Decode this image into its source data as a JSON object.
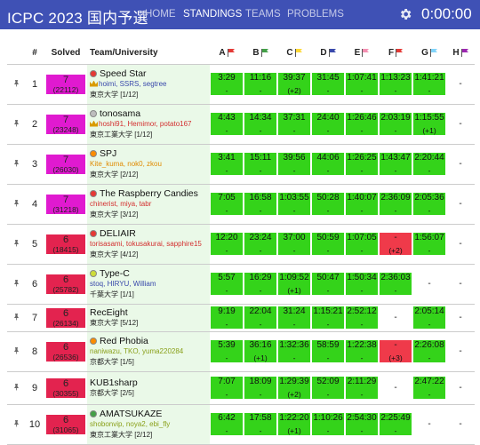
{
  "header": {
    "title": "ICPC 2023 国内予選",
    "nav": [
      {
        "label": "HOME",
        "active": false
      },
      {
        "label": "STANDINGS",
        "active": true
      },
      {
        "label": "TEAMS",
        "active": false
      },
      {
        "label": "PROBLEMS",
        "active": false
      }
    ],
    "clock": "0:00:00"
  },
  "columns": {
    "rank": "#",
    "solved": "Solved",
    "team": "Team/University",
    "problems": [
      {
        "letter": "A",
        "flag_color": "#e53935"
      },
      {
        "letter": "B",
        "flag_color": "#43a047"
      },
      {
        "letter": "C",
        "flag_color": "#fdd835"
      },
      {
        "letter": "D",
        "flag_color": "#3949ab"
      },
      {
        "letter": "E",
        "flag_color": "#f48fb1"
      },
      {
        "letter": "F",
        "flag_color": "#e53935"
      },
      {
        "letter": "G",
        "flag_color": "#81d4fa"
      },
      {
        "letter": "H",
        "flag_color": "#9c27b0"
      }
    ]
  },
  "teams": [
    {
      "rank": "1",
      "solved": "7",
      "penalty": "(22112)",
      "color": "magenta",
      "name": "Speed Star",
      "dot": "#e53935",
      "members": "hoimi, SSRS, segtree",
      "members_color": "blue",
      "univ": "東京大学 [1/12]",
      "crowns": true,
      "height": "row",
      "cells": [
        [
          "ac",
          "3:29",
          "-"
        ],
        [
          "ac",
          "11:16",
          "-"
        ],
        [
          "ac",
          "39:37",
          "(+2)"
        ],
        [
          "ac",
          "31:45",
          "-"
        ],
        [
          "ac",
          "1:07:41",
          "-"
        ],
        [
          "ac",
          "1:13:23",
          "-"
        ],
        [
          "ac",
          "1:41:21",
          "-"
        ],
        [
          "none",
          "-",
          ""
        ]
      ]
    },
    {
      "rank": "2",
      "solved": "7",
      "penalty": "(23248)",
      "color": "magenta",
      "name": "tonosama",
      "dot": "#bdbdbd",
      "members": "hoshi91, Hemimor, potato167",
      "members_color": "red",
      "univ": "東京工業大学 [1/12]",
      "crowns": true,
      "height": "row",
      "cells": [
        [
          "ac",
          "4:43",
          "-"
        ],
        [
          "ac",
          "14:34",
          "-"
        ],
        [
          "ac",
          "37:31",
          "-"
        ],
        [
          "ac",
          "24:40",
          "-"
        ],
        [
          "ac",
          "1:26:46",
          "-"
        ],
        [
          "ac",
          "2:03:19",
          "-"
        ],
        [
          "ac",
          "1:15:55",
          "(+1)"
        ],
        [
          "none",
          "-",
          ""
        ]
      ]
    },
    {
      "rank": "3",
      "solved": "7",
      "penalty": "(26030)",
      "color": "magenta",
      "name": "SPJ",
      "dot": "#fb8c00",
      "members": "Kite_kuma, nok0, zkou",
      "members_color": "orange",
      "univ": "東京大学 [2/12]",
      "crowns": false,
      "height": "row",
      "cells": [
        [
          "ac",
          "3:41",
          "-"
        ],
        [
          "ac",
          "15:11",
          "-"
        ],
        [
          "ac",
          "39:56",
          "-"
        ],
        [
          "ac",
          "44:06",
          "-"
        ],
        [
          "ac",
          "1:26:25",
          "-"
        ],
        [
          "ac",
          "1:43:47",
          "-"
        ],
        [
          "ac",
          "2:20:44",
          "-"
        ],
        [
          "none",
          "-",
          ""
        ]
      ]
    },
    {
      "rank": "4",
      "solved": "7",
      "penalty": "(31218)",
      "color": "magenta",
      "name": "The Raspberry Candies",
      "dot": "#e53935",
      "members": "chinerist, miya, tabr",
      "members_color": "red",
      "univ": "東京大学 [3/12]",
      "crowns": false,
      "height": "row",
      "cells": [
        [
          "ac",
          "7:05",
          "-"
        ],
        [
          "ac",
          "16:58",
          "-"
        ],
        [
          "ac",
          "1:03:55",
          "-"
        ],
        [
          "ac",
          "50:28",
          "-"
        ],
        [
          "ac",
          "1:40:07",
          "-"
        ],
        [
          "ac",
          "2:36:09",
          "-"
        ],
        [
          "ac",
          "2:05:36",
          "-"
        ],
        [
          "none",
          "-",
          ""
        ]
      ]
    },
    {
      "rank": "5",
      "solved": "6",
      "penalty": "(18415)",
      "color": "rose",
      "name": "DELIAIR",
      "dot": "#e53935",
      "members": "torisasami, tokusakurai, sapphire15",
      "members_color": "red",
      "univ": "東京大学 [4/12]",
      "crowns": false,
      "height": "row",
      "cells": [
        [
          "ac",
          "12:20",
          "-"
        ],
        [
          "ac",
          "23:24",
          "-"
        ],
        [
          "ac",
          "37:00",
          "-"
        ],
        [
          "ac",
          "50:59",
          "-"
        ],
        [
          "ac",
          "1:07:05",
          "-"
        ],
        [
          "wa",
          "-",
          "(+2)"
        ],
        [
          "ac",
          "1:56:07",
          "-"
        ],
        [
          "none",
          "-",
          ""
        ]
      ]
    },
    {
      "rank": "6",
      "solved": "6",
      "penalty": "(25782)",
      "color": "rose",
      "name": "Type-C",
      "dot": "#cddc39",
      "members": "stoq, HIRYU, William",
      "members_color": "blue",
      "univ": "千葉大学 [1/1]",
      "crowns": false,
      "height": "row",
      "cells": [
        [
          "ac",
          "5:57",
          "-"
        ],
        [
          "ac",
          "16:29",
          "-"
        ],
        [
          "ac",
          "1:09:52",
          "(+1)"
        ],
        [
          "ac",
          "50:47",
          "-"
        ],
        [
          "ac",
          "1:50:34",
          "-"
        ],
        [
          "ac",
          "2:36:03",
          "-"
        ],
        [
          "none",
          "-",
          ""
        ],
        [
          "none",
          "-",
          ""
        ]
      ]
    },
    {
      "rank": "7",
      "solved": "6",
      "penalty": "(26134)",
      "color": "rose",
      "name": "RecEight",
      "dot": "",
      "members": "",
      "members_color": "blue",
      "univ": "東京大学 [5/12]",
      "crowns": false,
      "height": "row h31",
      "cells": [
        [
          "ac",
          "9:19",
          "-"
        ],
        [
          "ac",
          "22:04",
          "-"
        ],
        [
          "ac",
          "31:24",
          "-"
        ],
        [
          "ac",
          "1:15:21",
          "-"
        ],
        [
          "ac",
          "2:52:12",
          "-"
        ],
        [
          "none",
          "-",
          ""
        ],
        [
          "ac",
          "2:05:14",
          "-"
        ],
        [
          "none",
          "-",
          ""
        ]
      ]
    },
    {
      "rank": "8",
      "solved": "6",
      "penalty": "(26536)",
      "color": "rose",
      "name": "Red Phobia",
      "dot": "#fb8c00",
      "members": "naniwazu, TKO, yuma220284",
      "members_color": "olive",
      "univ": "京都大学 [1/5]",
      "crowns": false,
      "height": "row",
      "cells": [
        [
          "ac",
          "5:39",
          "-"
        ],
        [
          "ac",
          "36:16",
          "(+1)"
        ],
        [
          "ac",
          "1:32:36",
          "-"
        ],
        [
          "ac",
          "58:59",
          "-"
        ],
        [
          "ac",
          "1:22:38",
          "-"
        ],
        [
          "wa",
          "-",
          "(+3)"
        ],
        [
          "ac",
          "2:26:08",
          "-"
        ],
        [
          "none",
          "-",
          ""
        ]
      ]
    },
    {
      "rank": "9",
      "solved": "6",
      "penalty": "(30355)",
      "color": "rose",
      "name": "KUB1sharp",
      "dot": "",
      "members": "",
      "members_color": "blue",
      "univ": "京都大学 [2/5]",
      "crowns": false,
      "height": "row h37",
      "cells": [
        [
          "ac",
          "7:07",
          "-"
        ],
        [
          "ac",
          "18:09",
          "-"
        ],
        [
          "ac",
          "1:29:39",
          "(+2)"
        ],
        [
          "ac",
          "52:09",
          "-"
        ],
        [
          "ac",
          "2:11:29",
          "-"
        ],
        [
          "none",
          "-",
          ""
        ],
        [
          "ac",
          "2:47:22",
          "-"
        ],
        [
          "none",
          "-",
          ""
        ]
      ]
    },
    {
      "rank": "10",
      "solved": "6",
      "penalty": "(31065)",
      "color": "rose",
      "name": "AMATSUKAZE",
      "dot": "#43a047",
      "members": "shobonvip, noya2, ebi_fly",
      "members_color": "olive",
      "univ": "東京工業大学 [2/12]",
      "crowns": false,
      "height": "row",
      "cells": [
        [
          "ac",
          "6:42",
          "-"
        ],
        [
          "ac",
          "17:58",
          "-"
        ],
        [
          "ac",
          "1:22:20",
          "(+1)"
        ],
        [
          "ac",
          "1:10:26",
          "-"
        ],
        [
          "ac",
          "2:54:30",
          "-"
        ],
        [
          "ac",
          "2:25:49",
          "-"
        ],
        [
          "none",
          "-",
          ""
        ],
        [
          "none",
          "-",
          ""
        ]
      ]
    }
  ]
}
